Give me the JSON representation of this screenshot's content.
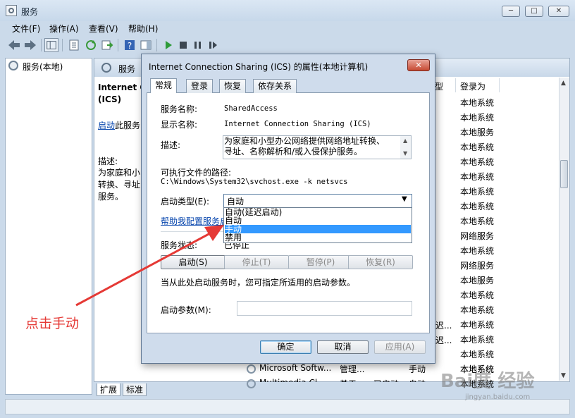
{
  "window": {
    "title": "服务",
    "minimize_label": "─",
    "maximize_label": "□",
    "close_label": "✕"
  },
  "menu": [
    "文件(F)",
    "操作(A)",
    "查看(V)",
    "帮助(H)"
  ],
  "tree": {
    "root": "服务(本地)"
  },
  "panel": {
    "header": "服务",
    "service_title_line1": "Internet C",
    "service_title_line2": "(ICS)",
    "start_link": "启动",
    "start_link_suffix": "此服务",
    "desc_label": "描述:",
    "desc_body": "为家庭和小 转换、寻址 服务。"
  },
  "columns": {
    "startup_type": "型",
    "logon_as": "登录为"
  },
  "logon_values": [
    "本地系统",
    "本地系统",
    "本地服务",
    "本地系统",
    "本地系统",
    "本地系统",
    "本地系统",
    "本地系统",
    "本地系统",
    "网络服务",
    "本地系统",
    "网络服务",
    "本地服务",
    "本地系统",
    "本地系统",
    "本地系统",
    "本地系统",
    "本地系统",
    "本地系统",
    "本地系统"
  ],
  "startup_fragments": [
    "迟...",
    "迟..."
  ],
  "list_rows": [
    {
      "name": "Microsoft Softw...",
      "desc": "管理...",
      "state": "",
      "startup": "手动",
      "logon": "本地系统"
    },
    {
      "name": "Multimedia Cl...",
      "desc": "基于...",
      "state": "已启动",
      "startup": "自动",
      "logon": "本地系统"
    }
  ],
  "bottom_tabs": [
    "扩展",
    "标准"
  ],
  "dialog": {
    "title": "Internet Connection Sharing (ICS) 的属性(本地计算机)",
    "close_label": "✕",
    "tabs": [
      "常规",
      "登录",
      "恢复",
      "依存关系"
    ],
    "service_name_label": "服务名称:",
    "service_name_value": "SharedAccess",
    "display_name_label": "显示名称:",
    "display_name_value": "Internet Connection Sharing (ICS)",
    "description_label": "描述:",
    "description_value": "为家庭和小型办公网络提供网络地址转换、寻址、名称解析和/或入侵保护服务。",
    "path_label": "可执行文件的路径:",
    "path_value": "C:\\Windows\\System32\\svchost.exe -k netsvcs",
    "startup_type_label": "启动类型(E):",
    "startup_type_value": "自动",
    "startup_options": [
      "自动(延迟启动)",
      "自动",
      "手动",
      "禁用"
    ],
    "startup_selected": "手动",
    "help_link": "帮助我配置服务启",
    "status_label": "服务状态:",
    "status_value": "已停止",
    "btn_start": "启动(S)",
    "btn_stop": "停止(T)",
    "btn_pause": "暂停(P)",
    "btn_resume": "恢复(R)",
    "hint": "当从此处启动服务时，您可指定所适用的启动参数。",
    "param_label": "启动参数(M):",
    "param_value": "",
    "btn_ok": "确定",
    "btn_cancel": "取消",
    "btn_apply": "应用(A)"
  },
  "annotation": {
    "text": "点击手动",
    "color": "#e53935"
  },
  "watermark": {
    "text": "Bai度 经验",
    "sub": "jingyan.baidu.com"
  }
}
